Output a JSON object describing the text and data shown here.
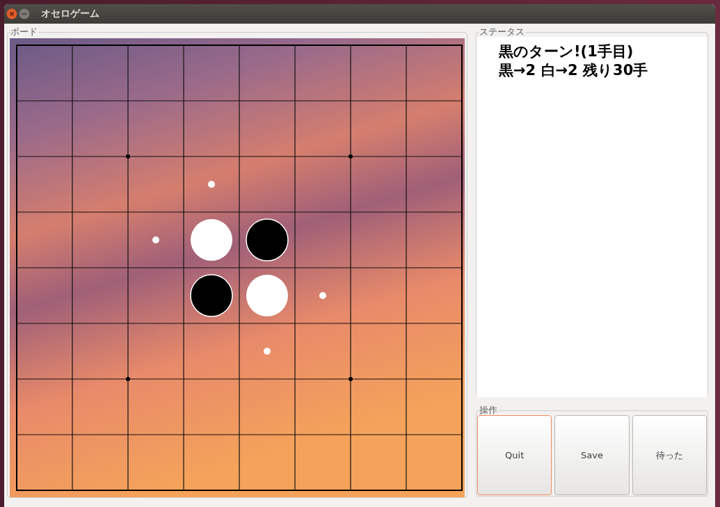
{
  "window": {
    "title": "オセロゲーム"
  },
  "board": {
    "label": "ボード",
    "rows": [
      {
        "cells": [
          {
            "kind": "empty"
          },
          {
            "kind": "empty"
          },
          {
            "kind": "empty"
          },
          {
            "kind": "empty"
          },
          {
            "kind": "empty"
          },
          {
            "kind": "empty"
          },
          {
            "kind": "empty"
          },
          {
            "kind": "empty"
          }
        ]
      },
      {
        "cells": [
          {
            "kind": "empty"
          },
          {
            "kind": "empty"
          },
          {
            "kind": "empty"
          },
          {
            "kind": "empty"
          },
          {
            "kind": "empty"
          },
          {
            "kind": "empty"
          },
          {
            "kind": "empty"
          },
          {
            "kind": "empty"
          }
        ]
      },
      {
        "cells": [
          {
            "kind": "empty"
          },
          {
            "kind": "empty"
          },
          {
            "kind": "empty"
          },
          {
            "kind": "hint"
          },
          {
            "kind": "empty"
          },
          {
            "kind": "empty"
          },
          {
            "kind": "empty"
          },
          {
            "kind": "empty"
          }
        ]
      },
      {
        "cells": [
          {
            "kind": "empty"
          },
          {
            "kind": "empty"
          },
          {
            "kind": "hint"
          },
          {
            "kind": "white"
          },
          {
            "kind": "black"
          },
          {
            "kind": "empty"
          },
          {
            "kind": "empty"
          },
          {
            "kind": "empty"
          }
        ]
      },
      {
        "cells": [
          {
            "kind": "empty"
          },
          {
            "kind": "empty"
          },
          {
            "kind": "empty"
          },
          {
            "kind": "black"
          },
          {
            "kind": "white"
          },
          {
            "kind": "hint"
          },
          {
            "kind": "empty"
          },
          {
            "kind": "empty"
          }
        ]
      },
      {
        "cells": [
          {
            "kind": "empty"
          },
          {
            "kind": "empty"
          },
          {
            "kind": "empty"
          },
          {
            "kind": "empty"
          },
          {
            "kind": "hint"
          },
          {
            "kind": "empty"
          },
          {
            "kind": "empty"
          },
          {
            "kind": "empty"
          }
        ]
      },
      {
        "cells": [
          {
            "kind": "empty"
          },
          {
            "kind": "empty"
          },
          {
            "kind": "empty"
          },
          {
            "kind": "empty"
          },
          {
            "kind": "empty"
          },
          {
            "kind": "empty"
          },
          {
            "kind": "empty"
          },
          {
            "kind": "empty"
          }
        ]
      },
      {
        "cells": [
          {
            "kind": "empty"
          },
          {
            "kind": "empty"
          },
          {
            "kind": "empty"
          },
          {
            "kind": "empty"
          },
          {
            "kind": "empty"
          },
          {
            "kind": "empty"
          },
          {
            "kind": "empty"
          },
          {
            "kind": "empty"
          }
        ]
      }
    ]
  },
  "status": {
    "label": "ステータス",
    "lines": [
      "黒のターン!(1手目)",
      "黒→2 白→2 残り30手"
    ]
  },
  "controls": {
    "label": "操作",
    "buttons": [
      {
        "label": "Quit",
        "selected": true
      },
      {
        "label": "Save",
        "selected": false
      },
      {
        "label": "待った",
        "selected": false
      }
    ]
  }
}
